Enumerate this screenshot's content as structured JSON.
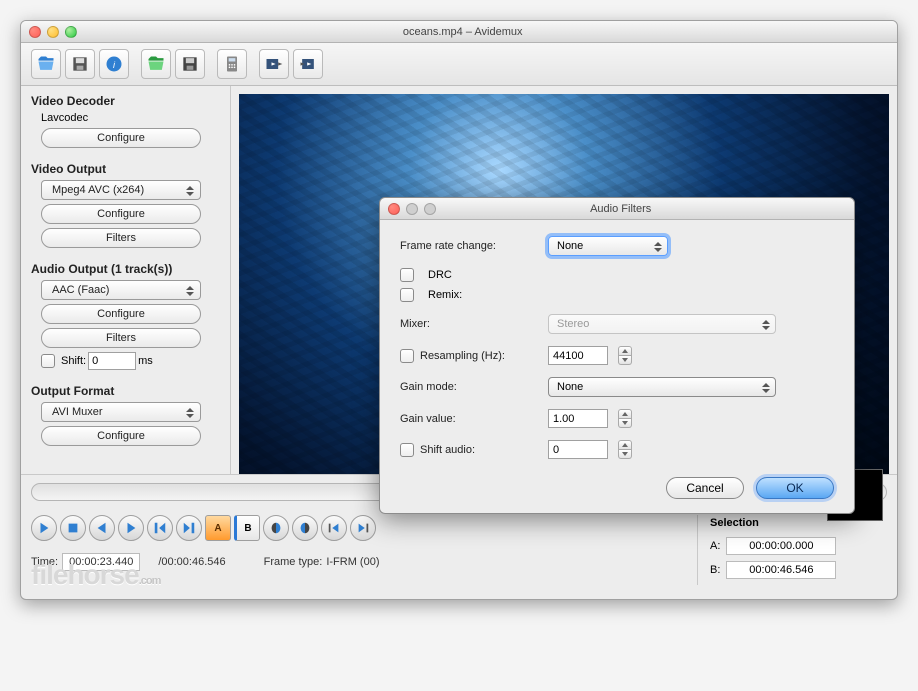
{
  "window": {
    "title": "oceans.mp4 – Avidemux"
  },
  "sidebar": {
    "video_decoder": {
      "title": "Video Decoder",
      "codec": "Lavcodec",
      "configure": "Configure"
    },
    "video_output": {
      "title": "Video Output",
      "selected": "Mpeg4 AVC (x264)",
      "configure": "Configure",
      "filters": "Filters"
    },
    "audio_output": {
      "title": "Audio Output (1 track(s))",
      "selected": "AAC (Faac)",
      "configure": "Configure",
      "filters": "Filters",
      "shift_label": "Shift:",
      "shift_value": "0",
      "shift_unit": "ms"
    },
    "output_format": {
      "title": "Output Format",
      "selected": "AVI Muxer",
      "configure": "Configure"
    }
  },
  "scrubber": {
    "knob_percent": 50
  },
  "time": {
    "label": "Time:",
    "current": "00:00:23.440",
    "total": "/00:00:46.546",
    "frame_type_label": "Frame type:",
    "frame_type": "I-FRM (00)"
  },
  "selection": {
    "title": "Selection",
    "a_label": "A:",
    "a_value": "00:00:00.000",
    "b_label": "B:",
    "b_value": "00:00:46.546"
  },
  "dialog": {
    "title": "Audio Filters",
    "frame_rate_label": "Frame rate change:",
    "frame_rate_value": "None",
    "drc_label": "DRC",
    "remix_label": "Remix:",
    "mixer_label": "Mixer:",
    "mixer_value": "Stereo",
    "resampling_label": "Resampling (Hz):",
    "resampling_value": "44100",
    "gain_mode_label": "Gain mode:",
    "gain_mode_value": "None",
    "gain_value_label": "Gain value:",
    "gain_value": "1.00",
    "shift_audio_label": "Shift audio:",
    "shift_audio_value": "0",
    "cancel": "Cancel",
    "ok": "OK"
  },
  "watermark": "filehorse.com"
}
